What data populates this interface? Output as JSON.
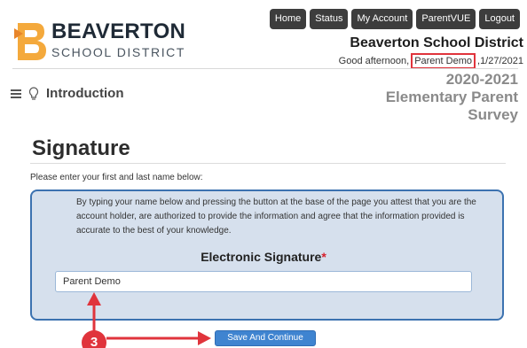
{
  "header": {
    "logo_name": "BEAVERTON",
    "logo_sub": "SCHOOL DISTRICT",
    "nav": [
      "Home",
      "Status",
      "My Account",
      "ParentVUE",
      "Logout"
    ],
    "district_title": "Beaverton School District",
    "greeting_prefix": "Good afternoon,",
    "user_name": "Parent Demo",
    "greeting_suffix": ",",
    "date": "1/27/2021"
  },
  "subheader": {
    "section_label": "Introduction",
    "survey_title_lines": [
      "2020-2021",
      "Elementary Parent",
      "Survey"
    ]
  },
  "page": {
    "heading": "Signature",
    "instructions": "Please enter your first and last name below:",
    "attestation": "By typing your name below and pressing the button at the base of the page you attest that you are the account holder, are authorized to provide the information and agree that the information provided is accurate to the best of your knowledge.",
    "signature_label": "Electronic Signature",
    "required_marker": "*",
    "signature_value": "Parent Demo",
    "save_label": "Save And Continue"
  },
  "annotation": {
    "step_number": "3",
    "accent_color": "#e0343c"
  },
  "colors": {
    "panel_bg": "#d6e0ed",
    "panel_border": "#3c72b0",
    "button_bg": "#3f84d0",
    "nav_bg": "#3d3d3d"
  }
}
